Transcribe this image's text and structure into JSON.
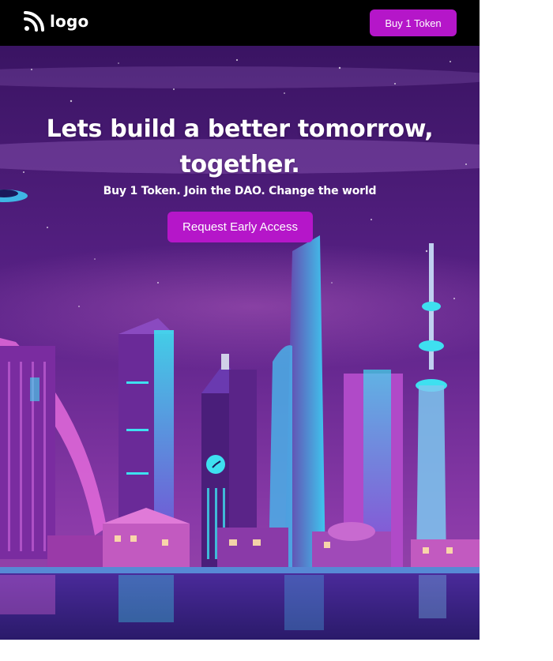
{
  "header": {
    "logo_text": "logo",
    "logo_icon": "rss-icon",
    "buy_button_label": "Buy 1 Token"
  },
  "hero": {
    "headline_line1": "Lets build a better tomorrow,",
    "headline_line2": "together.",
    "subheadline": "Buy 1 Token. Join the DAO. Change the world",
    "cta_label": "Request Early Access",
    "background_image": "neon-city-skyline"
  },
  "colors": {
    "accent": "#b516c9",
    "navbar": "#000000",
    "sky_top": "#3a1463",
    "sky_bottom": "#7a2aa0"
  }
}
